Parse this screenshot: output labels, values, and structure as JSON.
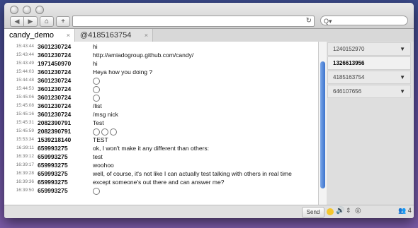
{
  "tabs": [
    {
      "label": "candy_demo",
      "close": "×"
    },
    {
      "label": "@4185163754",
      "close": "×"
    }
  ],
  "messages": [
    {
      "time": "15:43:44",
      "name": "3601230724",
      "msg": "hi"
    },
    {
      "time": "15:43:44",
      "name": "3601230724",
      "msg": "http://amiadogroup.github.com/candy/"
    },
    {
      "time": "15:43:49",
      "name": "1971450970",
      "msg": "hi"
    },
    {
      "time": "15:44:03",
      "name": "3601230724",
      "msg": "Heya how you doing ?"
    },
    {
      "time": "15:44:48",
      "name": "3601230724",
      "msg": ""
    },
    {
      "time": "15:44:53",
      "name": "3601230724",
      "msg": ""
    },
    {
      "time": "15:45:06",
      "name": "3601230724",
      "msg": ""
    },
    {
      "time": "15:45:08",
      "name": "3601230724",
      "msg": "/list"
    },
    {
      "time": "15:45:16",
      "name": "3601230724",
      "msg": "/msg nick"
    },
    {
      "time": "15:45:31",
      "name": "2082390791",
      "msg": "Test"
    },
    {
      "time": "15:45:59",
      "name": "2082390791",
      "msg": ""
    },
    {
      "time": "15:53:34",
      "name": "1539218140",
      "msg": "TEST"
    },
    {
      "time": "16:39:11",
      "name": "659993275",
      "msg": "ok, I won't make it any different than others:"
    },
    {
      "time": "16:39:12",
      "name": "659993275",
      "msg": "test"
    },
    {
      "time": "16:39:17",
      "name": "659993275",
      "msg": "woohoo"
    },
    {
      "time": "16:39:28",
      "name": "659993275",
      "msg": "well, of course, it's not like I can actually test talking with others in real time"
    },
    {
      "time": "16:39:36",
      "name": "659993275",
      "msg": "except someone's out there and can answer me?"
    },
    {
      "time": "16:39:50",
      "name": "659993275",
      "msg": ""
    }
  ],
  "sidebar": {
    "users": [
      {
        "id": "1240152970",
        "caret": "▼"
      },
      {
        "id": "1326613956",
        "caret": ""
      },
      {
        "id": "4185163754",
        "caret": "▼"
      },
      {
        "id": "646107656",
        "caret": "▼"
      }
    ]
  },
  "bottom": {
    "send_label": "Send",
    "user_count": "4"
  },
  "icons": {
    "back": "◀",
    "forward": "▶",
    "home": "⌂",
    "add": "+",
    "reload": "↻",
    "search": "Q▾",
    "sound": "🔊",
    "arrows": "⇕",
    "settings": "◎"
  }
}
